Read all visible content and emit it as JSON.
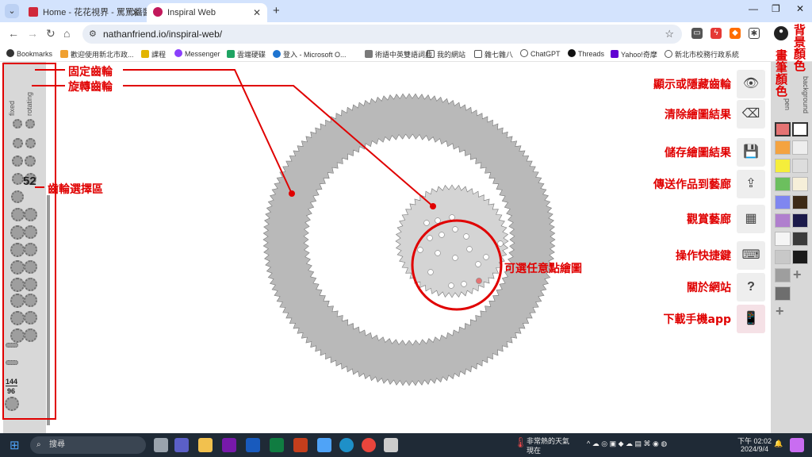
{
  "browser": {
    "tabs": [
      {
        "title": "Home - 花花視界 - 罵罵醬醬",
        "active": false,
        "favicon_color": "#d0283b"
      },
      {
        "title": "Inspiral Web",
        "active": true,
        "favicon_color": "#c2185b"
      }
    ],
    "url": "nathanfriend.io/inspiral-web/",
    "bookmarks": [
      {
        "label": "Bookmarks",
        "icon": "star-icon",
        "color": "#333333"
      },
      {
        "label": "歡迎使用新北市政...",
        "icon": "bookmark-favicon",
        "color": "#f0a030"
      },
      {
        "label": "課程",
        "icon": "bookmark-favicon",
        "color": "#e2b400"
      },
      {
        "label": "Messenger",
        "icon": "messenger-icon",
        "color": "#8a3ffc"
      },
      {
        "label": "雲端硬碟",
        "icon": "drive-icon",
        "color": "#1fa463"
      },
      {
        "label": "登入 - Microsoft O...",
        "icon": "cloud-icon",
        "color": "#1e74d0"
      },
      {
        "label": "術語中英雙語詞典",
        "icon": "bookmark-favicon",
        "color": "#7a7a7a"
      },
      {
        "label": "我的網站",
        "icon": "folder-icon",
        "color": "#555555"
      },
      {
        "label": "雜七雜八",
        "icon": "folder-icon",
        "color": "#555555"
      },
      {
        "label": "ChatGPT",
        "icon": "chatgpt-icon",
        "color": "#555555"
      },
      {
        "label": "Threads",
        "icon": "threads-icon",
        "color": "#111111"
      },
      {
        "label": "Yahoo!奇摩",
        "icon": "yahoo-icon",
        "color": "#6001d2"
      },
      {
        "label": "新北市校務行政系統",
        "icon": "globe-icon",
        "color": "#555555"
      }
    ]
  },
  "app": {
    "gear_panel": {
      "fixed_label": "fixed",
      "rotating_label": "rotating",
      "selected_rotating_number": "52",
      "ring_gear_numbers": [
        "144",
        "96"
      ]
    },
    "tool_buttons": [
      {
        "icon": "eye-icon",
        "annotation": "顯示或隱藏齒輪"
      },
      {
        "icon": "eraser-icon",
        "annotation": "清除繪圖結果"
      },
      {
        "icon": "save-icon",
        "annotation": "儲存繪圖結果"
      },
      {
        "icon": "upload-icon",
        "annotation": "傳送作品到藝廊"
      },
      {
        "icon": "grid-icon",
        "annotation": "觀賞藝廊"
      },
      {
        "icon": "keyboard-icon",
        "annotation": "操作快捷鍵"
      },
      {
        "icon": "question-icon",
        "annotation": "關於網站"
      },
      {
        "icon": "phone-icon",
        "annotation": "下載手機app"
      }
    ],
    "color_panel": {
      "pen_label": "pen",
      "background_label": "background",
      "pen_colors": [
        "#e57373",
        "#f4a340",
        "#f5ee3b",
        "#6cbf5e",
        "#7f86f0",
        "#b07fce",
        "#f5f5f5",
        "#c8c8c8",
        "#9e9e9e",
        "#6e6e6e"
      ],
      "background_colors": [
        "#ffffff",
        "#eeeeee",
        "#dddddd",
        "#f6efd9",
        "#3d2a16",
        "#1b1a4a",
        "#3a3a3a",
        "#1a1a1a"
      ]
    },
    "annotations": {
      "fixed_gear": "固定齒輪",
      "rotating_gear": "旋轉齒輪",
      "gear_select_area": "齒輪選擇區",
      "pick_hole": "可選任意點繪圖",
      "background_color": "背景顏色",
      "pen_color": "畫筆顏色"
    },
    "accent_red": "#e00000"
  },
  "taskbar": {
    "search_placeholder": "搜尋",
    "weather_text": "非常熱的天氣",
    "weather_sub": "現在",
    "time": "下午 02:02",
    "date": "2024/9/4"
  }
}
